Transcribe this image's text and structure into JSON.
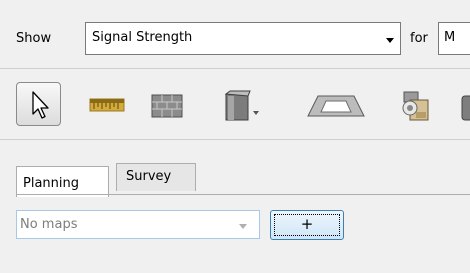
{
  "show_row": {
    "show_label": "Show",
    "show_value": "Signal Strength",
    "for_label": "for",
    "for_value": "M"
  },
  "tabs": [
    {
      "label": "Planning",
      "active": true
    },
    {
      "label": "Survey",
      "active": false
    }
  ],
  "maps": {
    "select_value": "No maps",
    "add_label": "+"
  },
  "toolbar": {
    "tools": [
      "select-arrow-icon",
      "measure-ruler-icon",
      "brick-wall-icon",
      "pillar-icon",
      "dropdown-icon",
      "floor-area-icon",
      "access-point-icon",
      "device-icon"
    ]
  }
}
